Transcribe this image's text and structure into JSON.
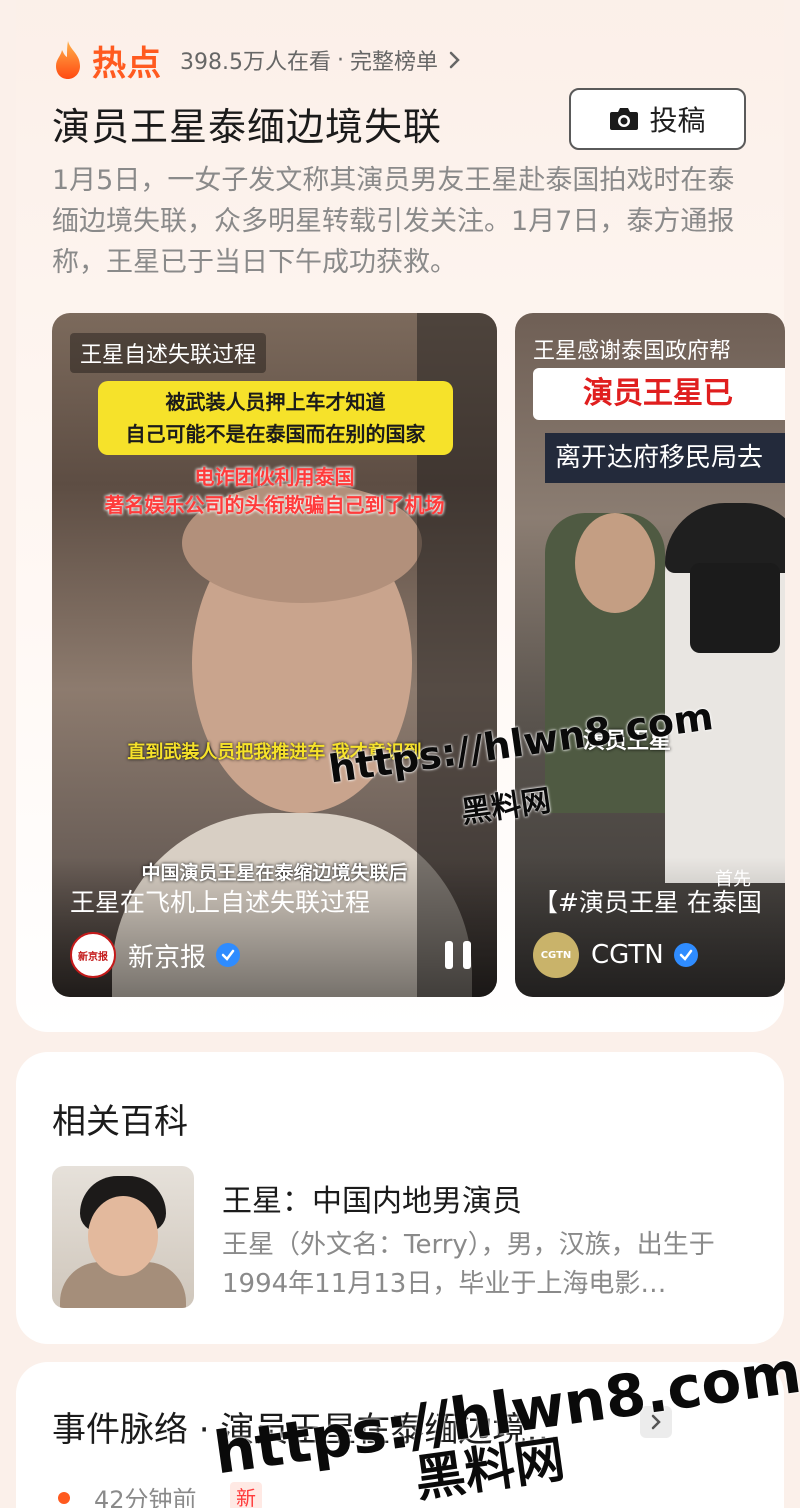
{
  "hot": {
    "label": "热点",
    "viewers": "398.5万人在看",
    "separator": "·",
    "full_list": "完整榜单",
    "accent_color": "#ff5a1f"
  },
  "topic": {
    "title": "演员王星泰缅边境失联",
    "submit_label": "投稿",
    "description": "1月5日，一女子发文称其演员男友王星赴泰国拍戏时在泰缅边境失联，众多明星转载引发关注。1月7日，泰方通报称，王星已于当日下午成功获救。"
  },
  "videos": [
    {
      "top_tag": "王星自述失联过程",
      "yellow_box_line1": "被武装人员押上车才知道",
      "yellow_box_line2": "自己可能不是在泰国而在别的国家",
      "red_caption_line1": "电诈团伙利用泰国",
      "red_caption_line2": "著名娱乐公司的头衔欺骗自己到了机场",
      "mid_subtitle": "直到武装人员把我推进车 我才意识到",
      "bottom_subtitle": "中国演员王星在泰缩边境失联后",
      "caption": "王星在飞机上自述失联过程",
      "author": "新京报",
      "avatar_text": "新京报"
    },
    {
      "top_tag": "王星感谢泰国政府帮",
      "red_banner": "演员王星已",
      "blue_banner": "离开达府移民局去",
      "name_tag": "演员王星",
      "small_tag": "首先",
      "caption": "【#演员王星 在泰国",
      "author": "CGTN",
      "avatar_text": "CGTN"
    }
  ],
  "wiki": {
    "heading": "相关百科",
    "title": "王星：中国内地男演员",
    "description": "王星（外文名：Terry），男，汉族，出生于1994年11月13日，毕业于上海电影…"
  },
  "timeline": {
    "heading": "事件脉络 · 演员王星在泰缅边境…",
    "first_time": "42分钟前",
    "first_badge": "新"
  },
  "watermarks": {
    "url": "https://hlwn8.com",
    "name": "黑料网"
  }
}
